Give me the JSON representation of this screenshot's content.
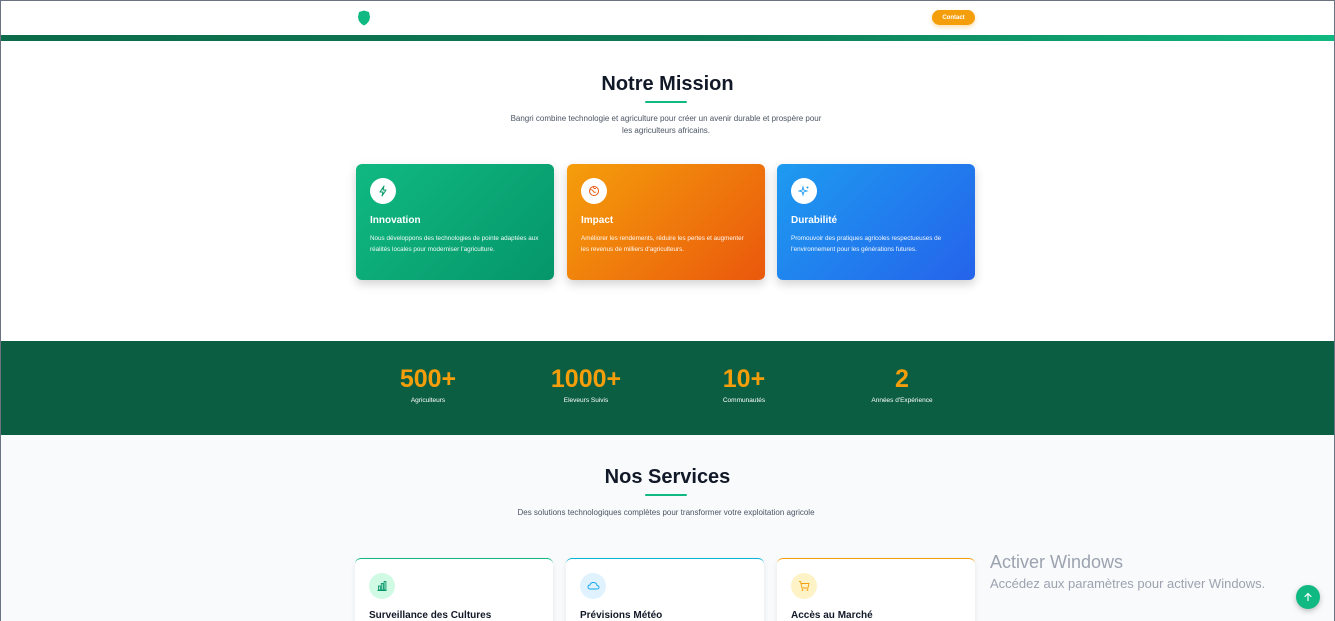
{
  "header": {
    "contact_label": "Contact"
  },
  "mission": {
    "title": "Notre Mission",
    "subtitle": "Bangri combine technologie et agriculture pour créer un avenir durable et prospère pour les agriculteurs africains.",
    "cards": [
      {
        "title": "Innovation",
        "text": "Nous développons des technologies de pointe adaptées aux réalités locales pour moderniser l'agriculture.",
        "icon": "bolt-icon"
      },
      {
        "title": "Impact",
        "text": "Améliorer les rendements, réduire les pertes et augmenter les revenus de milliers d'agriculteurs.",
        "icon": "globe-icon"
      },
      {
        "title": "Durabilité",
        "text": "Promouvoir des pratiques agricoles respectueuses de l'environnement pour les générations futures.",
        "icon": "sparkle-icon"
      }
    ]
  },
  "stats": [
    {
      "value": "500+",
      "label": "Agriculteurs"
    },
    {
      "value": "1000+",
      "label": "Eleveurs Suivis"
    },
    {
      "value": "10+",
      "label": "Communautés"
    },
    {
      "value": "2",
      "label": "Années d'Expérience"
    }
  ],
  "services": {
    "title": "Nos Services",
    "subtitle": "Des solutions technologiques complètes pour transformer votre exploitation agricole",
    "cards": [
      {
        "title": "Surveillance des Cultures",
        "icon": "bar-chart-icon"
      },
      {
        "title": "Prévisions Météo",
        "icon": "cloud-icon"
      },
      {
        "title": "Accès au Marché",
        "icon": "cart-icon"
      }
    ]
  },
  "watermark": {
    "title": "Activer Windows",
    "subtitle": "Accédez aux paramètres pour activer Windows."
  },
  "colors": {
    "primary": "#10b981",
    "dark_green": "#0b5e41",
    "accent": "#f59e0b",
    "blue": "#2563eb"
  }
}
